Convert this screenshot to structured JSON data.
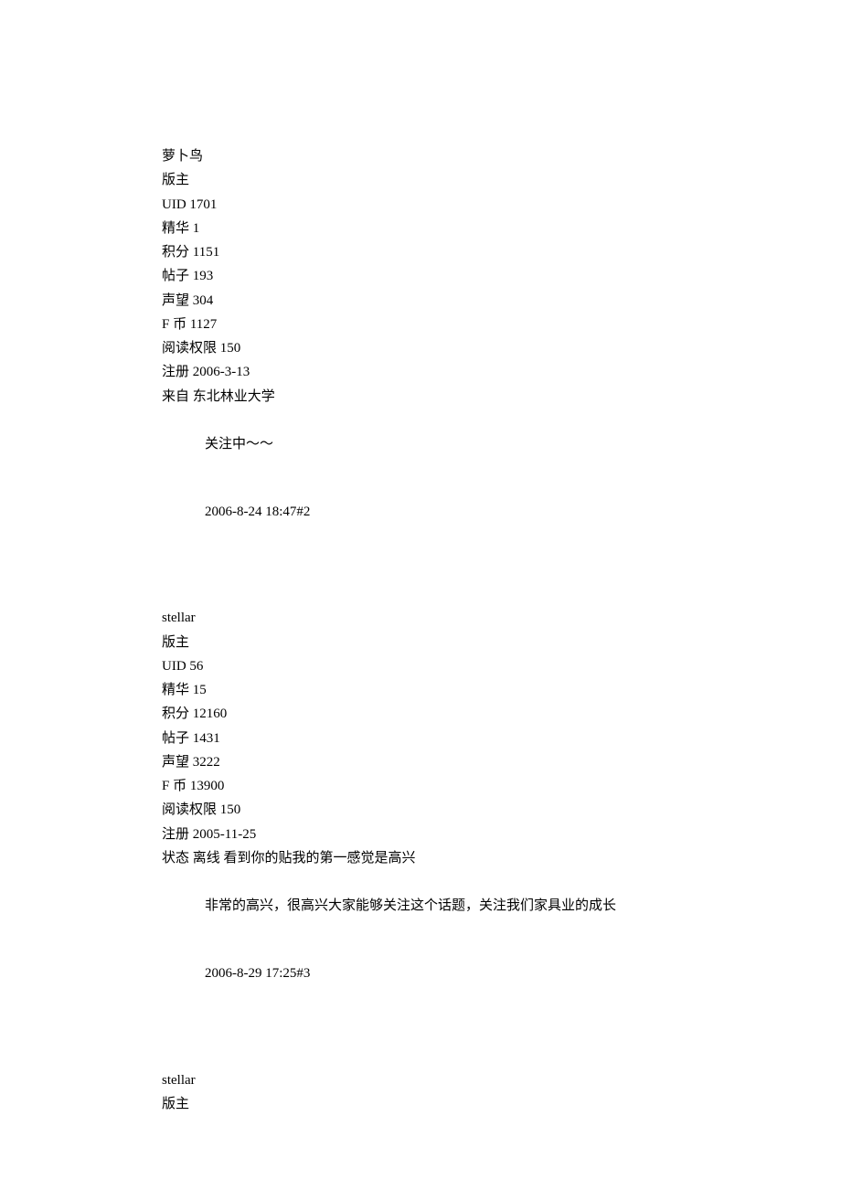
{
  "posts": [
    {
      "username": "萝卜鸟",
      "role": "版主",
      "fields": [
        {
          "label": "UID",
          "value": "1701"
        },
        {
          "label": "精华",
          "value": "1"
        },
        {
          "label": "积分",
          "value": "1151"
        },
        {
          "label": "帖子",
          "value": "193"
        },
        {
          "label": "声望",
          "value": "304"
        },
        {
          "label": "F 币",
          "value": "1127"
        },
        {
          "label": "阅读权限",
          "value": "150"
        },
        {
          "label": "注册",
          "value": "2006-3-13"
        },
        {
          "label": "来自",
          "value": "东北林业大学"
        }
      ],
      "content": "关注中～～",
      "timestamp": "2006-8-24 18:47",
      "floor": "#2"
    },
    {
      "username": "stellar",
      "role": "版主",
      "fields": [
        {
          "label": "UID",
          "value": "56"
        },
        {
          "label": "精华",
          "value": "15"
        },
        {
          "label": "积分",
          "value": "12160"
        },
        {
          "label": "帖子",
          "value": "1431"
        },
        {
          "label": "声望",
          "value": "3222"
        },
        {
          "label": "F 币",
          "value": "13900"
        },
        {
          "label": "阅读权限",
          "value": "150"
        },
        {
          "label": "注册",
          "value": "2005-11-25"
        }
      ],
      "status_label": "状态",
      "status_value": "离线",
      "reply_title": "看到你的贴我的第一感觉是高兴",
      "content": "非常的高兴，很高兴大家能够关注这个话题，关注我们家具业的成长",
      "timestamp": "2006-8-29 17:25",
      "floor": "#3"
    },
    {
      "username": "stellar",
      "role": "版主"
    }
  ]
}
